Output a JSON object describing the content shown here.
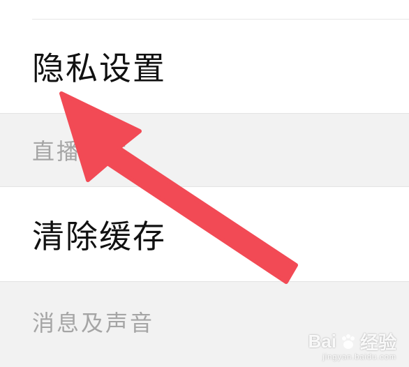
{
  "settings": {
    "items": [
      {
        "label": "隐私设置"
      },
      {
        "section": "直播相关"
      },
      {
        "label": "清除缓存"
      },
      {
        "section": "消息及声音"
      }
    ]
  },
  "overlay": {
    "arrow_color": "#f24a55"
  },
  "watermark": {
    "brand_a": "Bai",
    "brand_b": "经验",
    "sub": "jingyan.baidu.com"
  }
}
